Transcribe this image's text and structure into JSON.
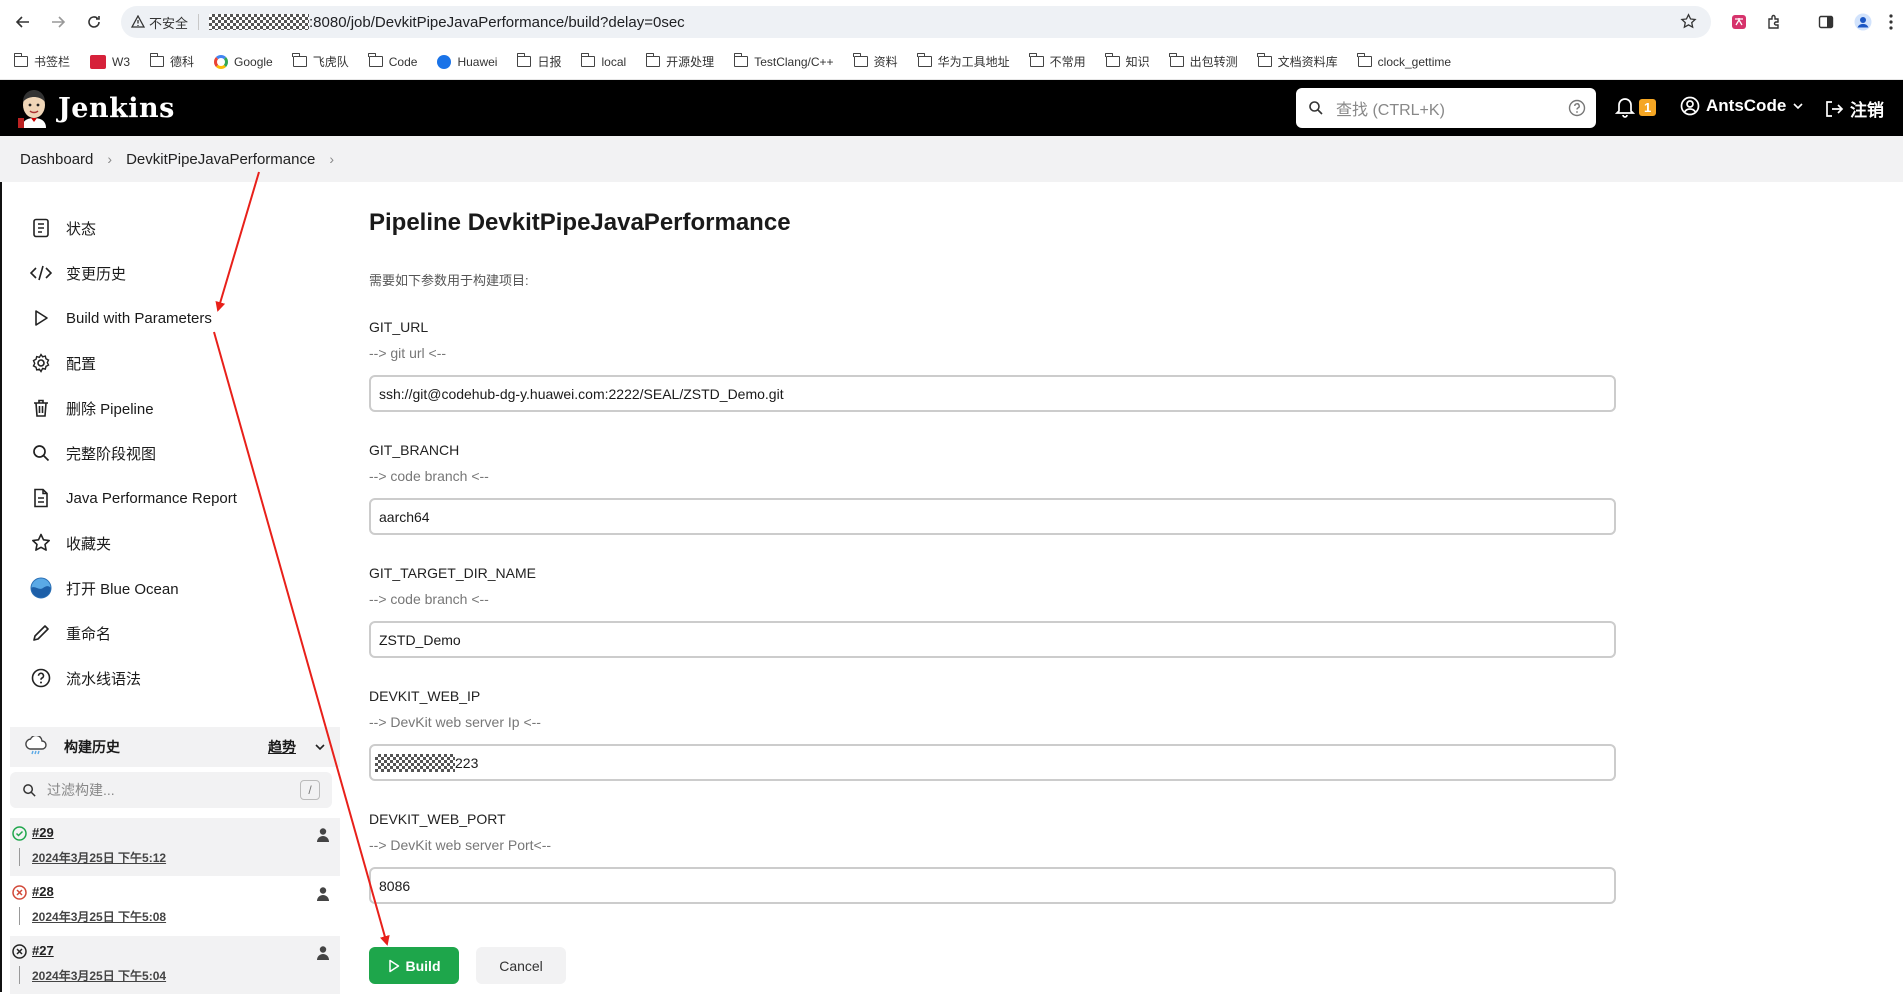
{
  "browser": {
    "security_label": "不安全",
    "url_tail": ":8080/job/DevkitPipeJavaPerformance/build?delay=0sec"
  },
  "bookmarks": [
    {
      "label": "书签栏",
      "icon": "folder-icon"
    },
    {
      "label": "W3",
      "icon": "w3-icon"
    },
    {
      "label": "德科",
      "icon": "folder-icon"
    },
    {
      "label": "Google",
      "icon": "google-icon"
    },
    {
      "label": "飞虎队",
      "icon": "folder-icon"
    },
    {
      "label": "Code",
      "icon": "folder-icon"
    },
    {
      "label": "Huawei",
      "icon": "huawei-icon"
    },
    {
      "label": "日报",
      "icon": "folder-icon"
    },
    {
      "label": "local",
      "icon": "folder-icon"
    },
    {
      "label": "开源处理",
      "icon": "folder-icon"
    },
    {
      "label": "TestClang/C++",
      "icon": "folder-icon"
    },
    {
      "label": "资料",
      "icon": "folder-icon"
    },
    {
      "label": "华为工具地址",
      "icon": "folder-icon"
    },
    {
      "label": "不常用",
      "icon": "folder-icon"
    },
    {
      "label": "知识",
      "icon": "folder-icon"
    },
    {
      "label": "出包转测",
      "icon": "folder-icon"
    },
    {
      "label": "文档资料库",
      "icon": "folder-icon"
    },
    {
      "label": "clock_gettime",
      "icon": "folder-icon"
    }
  ],
  "header": {
    "brand": "Jenkins",
    "search_placeholder": "查找 (CTRL+K)",
    "notification_count": "1",
    "user": "AntsCode",
    "logout": "注销"
  },
  "breadcrumb": [
    "Dashboard",
    "DevkitPipeJavaPerformance"
  ],
  "sidebar": {
    "items": [
      {
        "label": "状态",
        "icon": "status-icon"
      },
      {
        "label": "变更历史",
        "icon": "code-icon"
      },
      {
        "label": "Build with Parameters",
        "icon": "play-icon"
      },
      {
        "label": "配置",
        "icon": "gear-icon"
      },
      {
        "label": "删除 Pipeline",
        "icon": "trash-icon"
      },
      {
        "label": "完整阶段视图",
        "icon": "search-icon"
      },
      {
        "label": "Java Performance Report",
        "icon": "document-icon"
      },
      {
        "label": "收藏夹",
        "icon": "star-icon"
      },
      {
        "label": "打开 Blue Ocean",
        "icon": "blue-ocean-icon"
      },
      {
        "label": "重命名",
        "icon": "pencil-icon"
      },
      {
        "label": "流水线语法",
        "icon": "help-icon"
      }
    ],
    "history_title": "构建历史",
    "trend_label": "趋势",
    "filter_placeholder": "过滤构建...",
    "filter_shortcut": "/",
    "builds": [
      {
        "number": "#29",
        "date": "2024年3月25日 下午5:12",
        "status": "success"
      },
      {
        "number": "#28",
        "date": "2024年3月25日 下午5:08",
        "status": "failed"
      },
      {
        "number": "#27",
        "date": "2024年3月25日 下午5:04",
        "status": "aborted"
      }
    ]
  },
  "main": {
    "title": "Pipeline DevkitPipeJavaPerformance",
    "subtitle": "需要如下参数用于构建项目:",
    "params": [
      {
        "name": "GIT_URL",
        "desc": "--> git url <--",
        "value": "ssh://git@codehub-dg-y.huawei.com:2222/SEAL/ZSTD_Demo.git"
      },
      {
        "name": "GIT_BRANCH",
        "desc": "--> code branch <--",
        "value": "aarch64"
      },
      {
        "name": "GIT_TARGET_DIR_NAME",
        "desc": "--> code branch <--",
        "value": "ZSTD_Demo"
      },
      {
        "name": "DEVKIT_WEB_IP",
        "desc": "--> DevKit web server Ip <--",
        "value": "223"
      },
      {
        "name": "DEVKIT_WEB_PORT",
        "desc": "--> DevKit web server Port<--",
        "value": "8086"
      }
    ],
    "build_label": "Build",
    "cancel_label": "Cancel"
  },
  "colors": {
    "header_bg": "#000000",
    "build_button": "#1ea64b",
    "badge": "#f5a623",
    "annotation_arrow": "#e8201a"
  }
}
